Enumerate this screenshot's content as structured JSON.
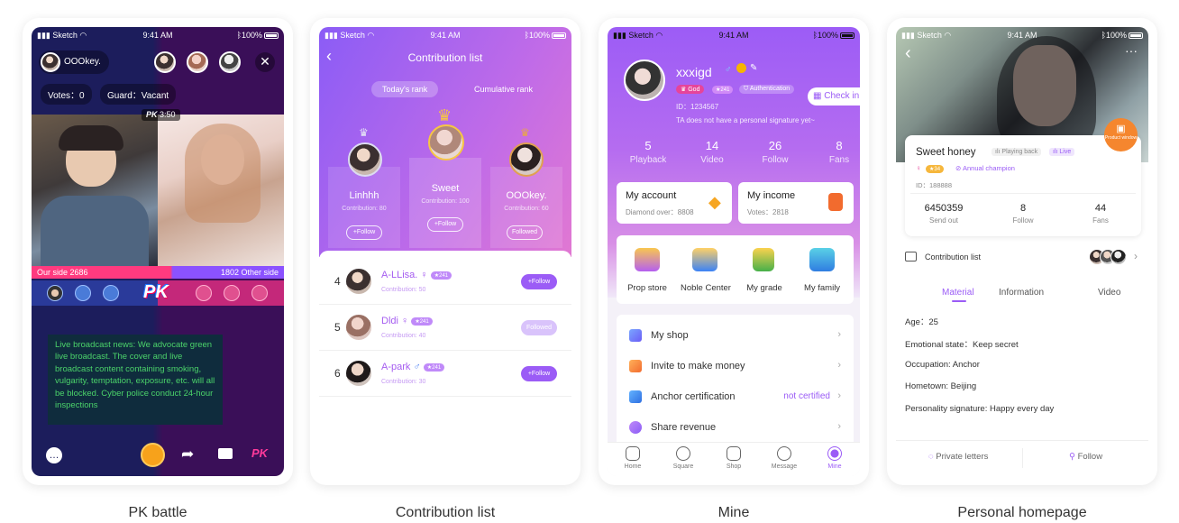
{
  "captions": [
    "PK battle",
    "Contribution list",
    "Mine",
    "Personal homepage"
  ],
  "status": {
    "carrier": "Sketch",
    "time": "9:41 AM",
    "battery": "100%"
  },
  "pk": {
    "host_name": "OOOkey.",
    "votes": "Votes：0",
    "guard": "Guard：Vacant",
    "timer": "3:50",
    "pk_tag": "PK",
    "our_side": "Our side  2686",
    "other_side": "1802  Other side",
    "news": "Live broadcast news: We advocate green live broadcast. The cover and live broadcast content containing smoking, vulgarity, temptation, exposure, etc. will all be blocked. Cyber police conduct 24-hour inspections",
    "logo": "PK"
  },
  "contribution": {
    "title": "Contribution list",
    "tabs": [
      "Today's rank",
      "Cumulative rank"
    ],
    "podium": [
      {
        "rank": "2",
        "name": "Linhhh",
        "sub": "Contribution: 80",
        "follow": "+Follow"
      },
      {
        "rank": "1",
        "name": "Sweet",
        "sub": "Contribution: 100",
        "follow": "+Follow"
      },
      {
        "rank": "3",
        "name": "OOOkey.",
        "sub": "Contribution: 60",
        "follow": "Followed"
      }
    ],
    "rows": [
      {
        "rank": "4",
        "name": "A-LLisa.",
        "level": "241",
        "sub": "Contribution: 50",
        "btn": "+Follow"
      },
      {
        "rank": "5",
        "name": "Dldi",
        "level": "241",
        "sub": "Contribution: 40",
        "btn": "Followed"
      },
      {
        "rank": "6",
        "name": "A-park",
        "level": "241",
        "sub": "Contribution: 30",
        "btn": "+Follow"
      }
    ]
  },
  "mine": {
    "name": "xxxigd",
    "badge_god": "God",
    "level": "241",
    "auth": "Authentication",
    "id": "ID：1234567",
    "signature": "TA does not have a personal signature yet~",
    "checkin": "Check in",
    "stats": [
      {
        "n": "5",
        "l": "Playback"
      },
      {
        "n": "14",
        "l": "Video"
      },
      {
        "n": "26",
        "l": "Follow"
      },
      {
        "n": "8",
        "l": "Fans"
      }
    ],
    "account": {
      "title": "My account",
      "sub": "Diamond over：8808"
    },
    "income": {
      "title": "My income",
      "sub": "Votes：2818"
    },
    "grid": [
      "Prop store",
      "Noble Center",
      "My grade",
      "My family"
    ],
    "menu": [
      {
        "label": "My shop",
        "value": ""
      },
      {
        "label": "Invite to make money",
        "value": ""
      },
      {
        "label": "Anchor certification",
        "value": "not certified"
      },
      {
        "label": "Share revenue",
        "value": ""
      }
    ],
    "tabbar": [
      "Home",
      "Square",
      "Shop",
      "Message",
      "Mine"
    ]
  },
  "personal": {
    "name": "Sweet honey",
    "playing_back": "Playing back",
    "live": "Live",
    "level": "34",
    "champion": "Annual champion",
    "id": "ID：188888",
    "product_window": "Product window",
    "stats": [
      {
        "n": "6450359",
        "l": "Send out"
      },
      {
        "n": "8",
        "l": "Follow"
      },
      {
        "n": "44",
        "l": "Fans"
      }
    ],
    "contribution_label": "Contribution list",
    "tabs": [
      "Material",
      "Information",
      "Video"
    ],
    "info": [
      "Age：25",
      "Emotional state：Keep secret",
      "Occupation: Anchor",
      "Hometown: Beijing",
      "Personality signature: Happy every day"
    ],
    "private_letters": "Private letters",
    "follow": "Follow"
  },
  "colors": {
    "accent": "#9b5cf6",
    "pink": "#ff3a7f",
    "orange": "#f5862e"
  }
}
